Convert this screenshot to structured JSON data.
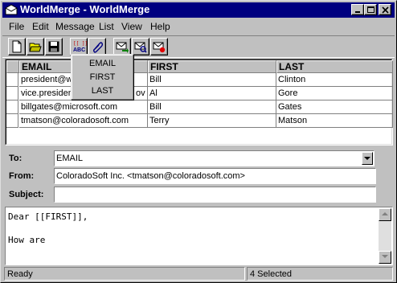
{
  "window": {
    "title": "WorldMerge - WorldMerge"
  },
  "menu": {
    "items": [
      "File",
      "Edit",
      "Message",
      "List",
      "View",
      "Help"
    ]
  },
  "toolbar": {
    "buttons": [
      "new-icon",
      "open-folder-icon",
      "save-disk-icon",
      "insert-field-icon",
      "attach-paperclip-icon",
      "send-mail-icon",
      "preview-mail-icon",
      "stop-mail-icon"
    ]
  },
  "grid": {
    "columns": [
      "EMAIL",
      "FIRST",
      "LAST"
    ],
    "rows": [
      [
        "president@w",
        "Bill",
        "Clinton"
      ],
      [
        "vice.presiden",
        "ov",
        "Al",
        "Gore"
      ],
      [
        "billgates@microsoft.com",
        "Bill",
        "Gates"
      ],
      [
        "tmatson@coloradosoft.com",
        "Terry",
        "Matson"
      ]
    ],
    "row_email": [
      "president@w",
      "vice.presiden",
      "billgates@microsoft.com",
      "tmatson@coloradosoft.com"
    ],
    "row_email_tail": [
      "",
      "ov",
      "",
      ""
    ],
    "row_first": [
      "Bill",
      "Al",
      "Bill",
      "Terry"
    ],
    "row_last": [
      "Clinton",
      "Gore",
      "Gates",
      "Matson"
    ]
  },
  "field_popup": {
    "items": [
      "EMAIL",
      "FIRST",
      "LAST"
    ]
  },
  "compose": {
    "to_label": "To:",
    "to_value": "EMAIL",
    "from_label": "From:",
    "from_value": "ColoradoSoft Inc. <tmatson@coloradosoft.com>",
    "subject_label": "Subject:",
    "subject_value": "",
    "body_lines": [
      "Dear [[FIRST]],",
      "",
      "How are"
    ]
  },
  "status": {
    "left": "Ready",
    "right": "4 Selected"
  },
  "colors": {
    "title_bar": "#000080",
    "face": "#c0c0c0"
  }
}
